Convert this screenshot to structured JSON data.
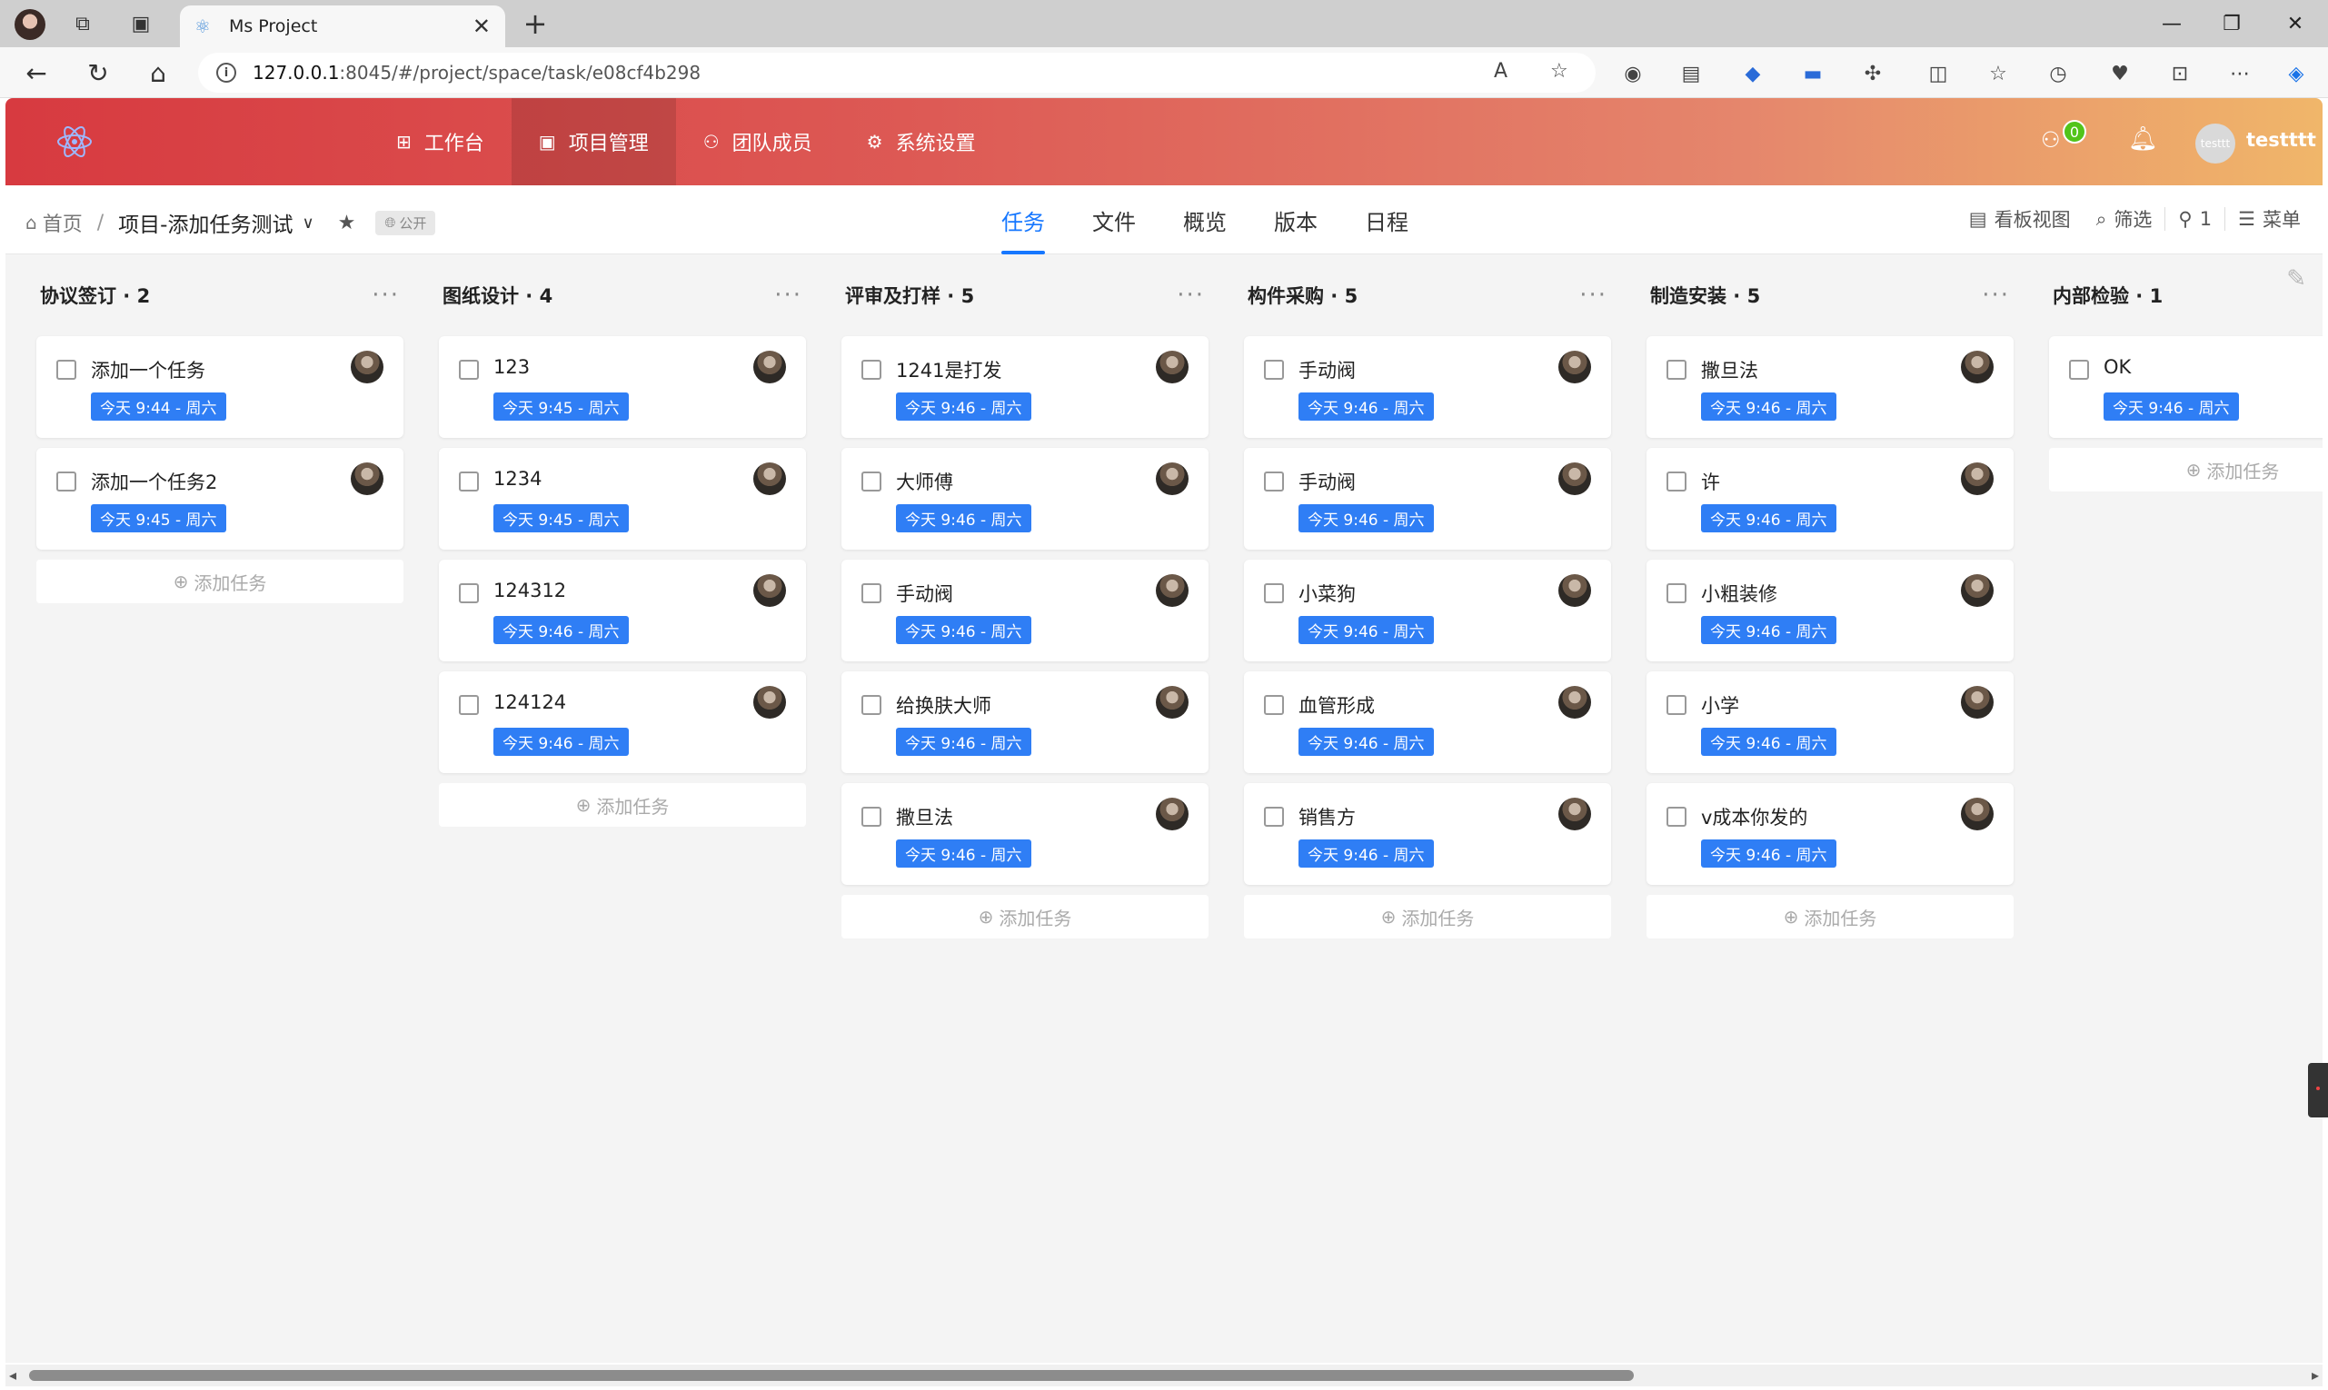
{
  "browser": {
    "tab_title": "Ms Project",
    "url_host": "127.0.0.1",
    "url_rest": ":8045/#/project/space/task/e08cf4b298"
  },
  "header": {
    "nav": [
      {
        "label": "工作台",
        "icon": "grid-icon"
      },
      {
        "label": "项目管理",
        "icon": "project-icon"
      },
      {
        "label": "团队成员",
        "icon": "team-icon"
      },
      {
        "label": "系统设置",
        "icon": "gear-icon"
      }
    ],
    "notification_count": "0",
    "user_avatar_text": "testtt",
    "user_name": "testttt"
  },
  "subheader": {
    "home": "首页",
    "separator": "/",
    "project_name": "项目-添加任务测试",
    "visibility": "公开",
    "tabs": [
      "任务",
      "文件",
      "概览",
      "版本",
      "日程"
    ],
    "tools": {
      "board_view": "看板视图",
      "filter": "筛选",
      "members": "1",
      "menu": "菜单"
    }
  },
  "board": {
    "add_task_label": "添加任务",
    "columns": [
      {
        "title": "协议签订 · 2",
        "tasks": [
          {
            "name": "添加一个任务",
            "date": "今天 9:44 - 周六"
          },
          {
            "name": "添加一个任务2",
            "date": "今天 9:45 - 周六"
          }
        ]
      },
      {
        "title": "图纸设计 · 4",
        "tasks": [
          {
            "name": "123",
            "date": "今天 9:45 - 周六"
          },
          {
            "name": "1234",
            "date": "今天 9:45 - 周六"
          },
          {
            "name": "124312",
            "date": "今天 9:46 - 周六"
          },
          {
            "name": "124124",
            "date": "今天 9:46 - 周六"
          }
        ]
      },
      {
        "title": "评审及打样 · 5",
        "tasks": [
          {
            "name": "1241是打发",
            "date": "今天 9:46 - 周六"
          },
          {
            "name": "大师傅",
            "date": "今天 9:46 - 周六"
          },
          {
            "name": "手动阀",
            "date": "今天 9:46 - 周六"
          },
          {
            "name": "给换肤大师",
            "date": "今天 9:46 - 周六"
          },
          {
            "name": "撒旦法",
            "date": "今天 9:46 - 周六"
          }
        ]
      },
      {
        "title": "构件采购 · 5",
        "tasks": [
          {
            "name": "手动阀",
            "date": "今天 9:46 - 周六"
          },
          {
            "name": "手动阀",
            "date": "今天 9:46 - 周六"
          },
          {
            "name": "小菜狗",
            "date": "今天 9:46 - 周六"
          },
          {
            "name": "血管形成",
            "date": "今天 9:46 - 周六"
          },
          {
            "name": "销售方",
            "date": "今天 9:46 - 周六"
          }
        ]
      },
      {
        "title": "制造安装 · 5",
        "tasks": [
          {
            "name": "撒旦法",
            "date": "今天 9:46 - 周六"
          },
          {
            "name": "许",
            "date": "今天 9:46 - 周六"
          },
          {
            "name": "小粗装修",
            "date": "今天 9:46 - 周六"
          },
          {
            "name": "小学",
            "date": "今天 9:46 - 周六"
          },
          {
            "name": "v成本你发的",
            "date": "今天 9:46 - 周六"
          }
        ]
      },
      {
        "title": "内部检验 · 1",
        "tasks": [
          {
            "name": "OK",
            "date": "今天 9:46 - 周六"
          }
        ]
      }
    ]
  },
  "colors": {
    "header_gradient_start": "#d73a40",
    "header_gradient_end": "#f0b66a",
    "accent": "#1677ff",
    "date_badge": "#2f7ef5",
    "notification_badge": "#52c41a"
  }
}
